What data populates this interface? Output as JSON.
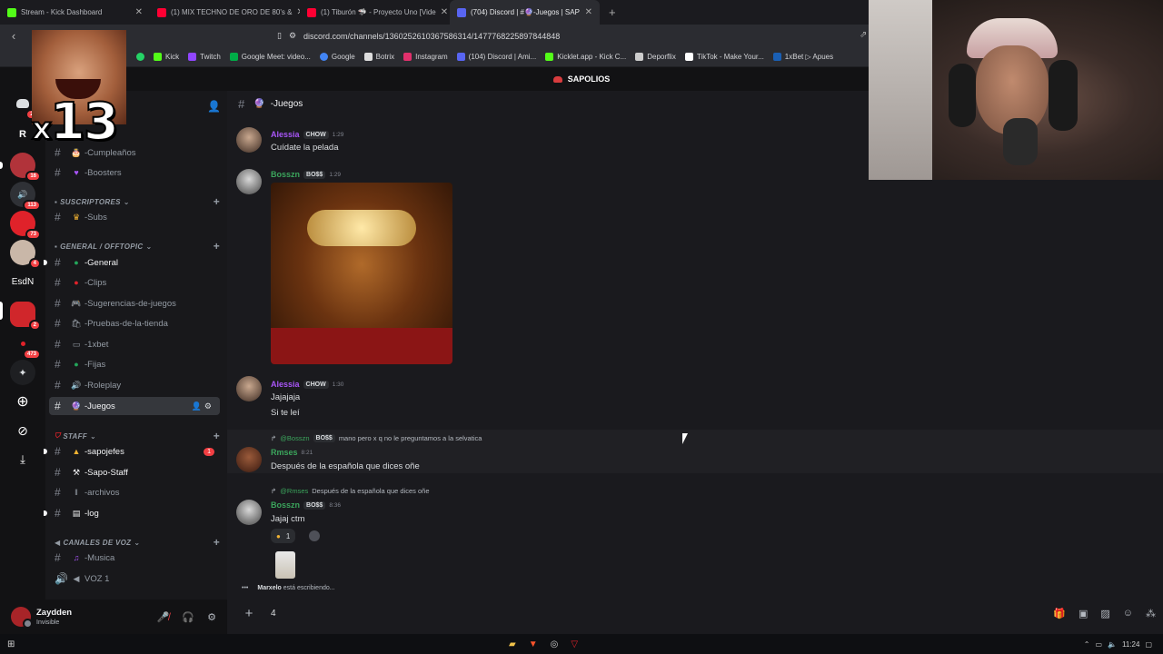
{
  "browser": {
    "tabs": [
      {
        "label": "Stream - Kick Dashboard",
        "color": "#53fc18"
      },
      {
        "label": "(1) MIX TECHNO DE ORO DE 80's & ",
        "color": "#ff0033"
      },
      {
        "label": "(1) Tiburón 🦈 - Proyecto Uno [Vide",
        "color": "#ff0033"
      },
      {
        "label": "(704) Discord | #🔮-Juegos | SAP",
        "color": "#5865f2",
        "active": true
      }
    ],
    "url": "discord.com/channels/1360252610367586314/1477768225897844848",
    "bookmarks": [
      {
        "label": "Kick",
        "color": "#53fc18"
      },
      {
        "label": "Twitch",
        "color": "#9146ff"
      },
      {
        "label": "Google Meet: video...",
        "color": "#00ac47"
      },
      {
        "label": "Google",
        "color": "#4285f4"
      },
      {
        "label": "Botrix",
        "color": "#dddddd"
      },
      {
        "label": "Instagram",
        "color": "#e1306c"
      },
      {
        "label": "(104) Discord | Ami...",
        "color": "#5865f2"
      },
      {
        "label": "Kicklet.app - Kick C...",
        "color": "#53fc18"
      },
      {
        "label": "Deporflix",
        "color": "#cccccc"
      },
      {
        "label": "TikTok - Make Your...",
        "color": "#ffffff"
      },
      {
        "label": "1xBet ▷ Apues",
        "color": "#1a5fb4"
      }
    ]
  },
  "server": {
    "name": "SAPOLIOS"
  },
  "guilds": [
    {
      "letter": "",
      "color": "#5865f2",
      "badge": "25"
    },
    {
      "letter": "R",
      "color": "#121214",
      "badge": ""
    },
    {
      "letter": "",
      "color": "#b1333a",
      "badge": "16"
    },
    {
      "letter": "",
      "color": "#2f3136",
      "badge": "113"
    },
    {
      "letter": "",
      "color": "#e0222a",
      "badge": "73"
    },
    {
      "letter": "",
      "color": "#c9b7a8",
      "badge": "4"
    },
    {
      "letter": "EsdN",
      "color": "#121214",
      "badge": ""
    },
    {
      "letter": "",
      "color": "#d0262b",
      "badge": "2"
    },
    {
      "letter": "",
      "color": "#121214",
      "badge": "473"
    }
  ],
  "channels": {
    "partial_top": "-Cumpleaños",
    "items": [
      {
        "label": "-Boosters",
        "emoji": "💜"
      },
      {
        "label": "-Subs",
        "emoji": "👑"
      },
      {
        "label": "-General",
        "emoji": "🟢",
        "bright": true
      },
      {
        "label": "-Clips",
        "emoji": "🔴"
      },
      {
        "label": "-Sugerencias-de-juegos",
        "emoji": "🎮"
      },
      {
        "label": "-Pruebas-de-la-tienda",
        "emoji": "🛍"
      },
      {
        "label": "-1xbet",
        "emoji": "▭"
      },
      {
        "label": "-Fijas",
        "emoji": "🟢"
      },
      {
        "label": "-Roleplay",
        "emoji": "🔊"
      },
      {
        "label": "-Juegos",
        "emoji": "🔮"
      },
      {
        "label": "-sapojefes",
        "emoji": "🔺",
        "mention": "1"
      },
      {
        "label": "-Sapo-Staff",
        "emoji": "⚒"
      },
      {
        "label": "-archivos",
        "emoji": "ǁ"
      },
      {
        "label": "-log",
        "emoji": "▤"
      },
      {
        "label": "-Musica",
        "emoji": "🎵"
      },
      {
        "label": "VOZ 1",
        "emoji": "🔊"
      }
    ],
    "categories": [
      "SUSCRIPTORES",
      "GENERAL / OFFTOPIC",
      "STAFF",
      "CANALES DE VOZ"
    ]
  },
  "user": {
    "name": "Zaydden",
    "status": "Invisible"
  },
  "chat": {
    "channel": "-Juegos",
    "messages": [
      {
        "author": "Alessia",
        "tag": "CHOW",
        "time": "1:29",
        "lines": [
          "Cuídate la pelada"
        ],
        "color": "#a855f7"
      },
      {
        "author": "Bosszn",
        "tag": "BO$$",
        "time": "1:29",
        "lines": [],
        "color": "#3ba55c"
      },
      {
        "author": "Alessia",
        "tag": "CHOW",
        "time": "1:30",
        "lines": [
          "Jajajaja",
          "Si te leí"
        ],
        "color": "#a855f7"
      },
      {
        "reply_to": "@Bosszn",
        "reply_tag": "BO$$",
        "reply_text": "mano pero x q no le preguntamos a la selvatica",
        "author": "Rmses",
        "time": "8:21",
        "lines": [
          "Después de la española que dices oñe"
        ],
        "color": "#3ba55c"
      },
      {
        "reply_to": "@Rmses",
        "reply_text": "Después de la española que dices oñe",
        "author": "Bosszn",
        "tag": "BO$$",
        "time": "8:36",
        "lines": [
          "Jajaj ctm"
        ],
        "color": "#3ba55c"
      }
    ],
    "reaction_count": "1",
    "typing_user": "Marxelo",
    "typing_text": "está escribiendo...",
    "composer_value": "4"
  },
  "overlay": {
    "multiplier_x": "x",
    "multiplier_n": "13"
  },
  "taskbar": {
    "time": "11:24"
  }
}
